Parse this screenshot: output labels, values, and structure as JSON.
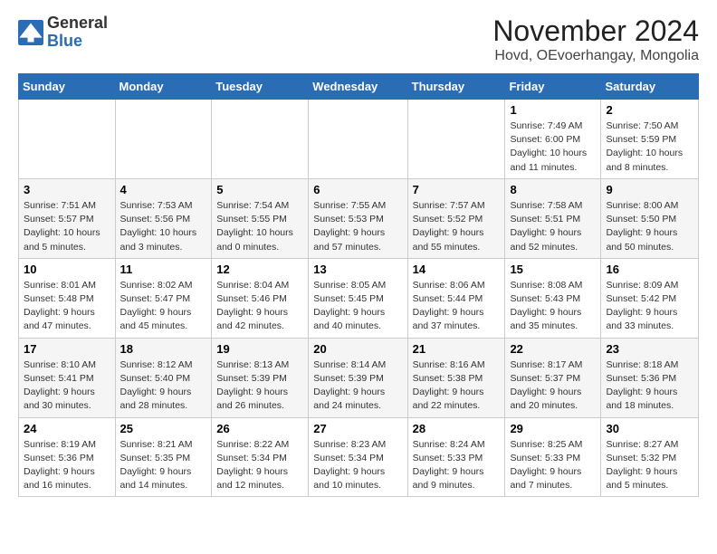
{
  "logo": {
    "general": "General",
    "blue": "Blue"
  },
  "title": "November 2024",
  "subtitle": "Hovd, OEvoerhangay, Mongolia",
  "weekdays": [
    "Sunday",
    "Monday",
    "Tuesday",
    "Wednesday",
    "Thursday",
    "Friday",
    "Saturday"
  ],
  "weeks": [
    [
      {
        "day": "",
        "info": ""
      },
      {
        "day": "",
        "info": ""
      },
      {
        "day": "",
        "info": ""
      },
      {
        "day": "",
        "info": ""
      },
      {
        "day": "",
        "info": ""
      },
      {
        "day": "1",
        "info": "Sunrise: 7:49 AM\nSunset: 6:00 PM\nDaylight: 10 hours\nand 11 minutes."
      },
      {
        "day": "2",
        "info": "Sunrise: 7:50 AM\nSunset: 5:59 PM\nDaylight: 10 hours\nand 8 minutes."
      }
    ],
    [
      {
        "day": "3",
        "info": "Sunrise: 7:51 AM\nSunset: 5:57 PM\nDaylight: 10 hours\nand 5 minutes."
      },
      {
        "day": "4",
        "info": "Sunrise: 7:53 AM\nSunset: 5:56 PM\nDaylight: 10 hours\nand 3 minutes."
      },
      {
        "day": "5",
        "info": "Sunrise: 7:54 AM\nSunset: 5:55 PM\nDaylight: 10 hours\nand 0 minutes."
      },
      {
        "day": "6",
        "info": "Sunrise: 7:55 AM\nSunset: 5:53 PM\nDaylight: 9 hours\nand 57 minutes."
      },
      {
        "day": "7",
        "info": "Sunrise: 7:57 AM\nSunset: 5:52 PM\nDaylight: 9 hours\nand 55 minutes."
      },
      {
        "day": "8",
        "info": "Sunrise: 7:58 AM\nSunset: 5:51 PM\nDaylight: 9 hours\nand 52 minutes."
      },
      {
        "day": "9",
        "info": "Sunrise: 8:00 AM\nSunset: 5:50 PM\nDaylight: 9 hours\nand 50 minutes."
      }
    ],
    [
      {
        "day": "10",
        "info": "Sunrise: 8:01 AM\nSunset: 5:48 PM\nDaylight: 9 hours\nand 47 minutes."
      },
      {
        "day": "11",
        "info": "Sunrise: 8:02 AM\nSunset: 5:47 PM\nDaylight: 9 hours\nand 45 minutes."
      },
      {
        "day": "12",
        "info": "Sunrise: 8:04 AM\nSunset: 5:46 PM\nDaylight: 9 hours\nand 42 minutes."
      },
      {
        "day": "13",
        "info": "Sunrise: 8:05 AM\nSunset: 5:45 PM\nDaylight: 9 hours\nand 40 minutes."
      },
      {
        "day": "14",
        "info": "Sunrise: 8:06 AM\nSunset: 5:44 PM\nDaylight: 9 hours\nand 37 minutes."
      },
      {
        "day": "15",
        "info": "Sunrise: 8:08 AM\nSunset: 5:43 PM\nDaylight: 9 hours\nand 35 minutes."
      },
      {
        "day": "16",
        "info": "Sunrise: 8:09 AM\nSunset: 5:42 PM\nDaylight: 9 hours\nand 33 minutes."
      }
    ],
    [
      {
        "day": "17",
        "info": "Sunrise: 8:10 AM\nSunset: 5:41 PM\nDaylight: 9 hours\nand 30 minutes."
      },
      {
        "day": "18",
        "info": "Sunrise: 8:12 AM\nSunset: 5:40 PM\nDaylight: 9 hours\nand 28 minutes."
      },
      {
        "day": "19",
        "info": "Sunrise: 8:13 AM\nSunset: 5:39 PM\nDaylight: 9 hours\nand 26 minutes."
      },
      {
        "day": "20",
        "info": "Sunrise: 8:14 AM\nSunset: 5:39 PM\nDaylight: 9 hours\nand 24 minutes."
      },
      {
        "day": "21",
        "info": "Sunrise: 8:16 AM\nSunset: 5:38 PM\nDaylight: 9 hours\nand 22 minutes."
      },
      {
        "day": "22",
        "info": "Sunrise: 8:17 AM\nSunset: 5:37 PM\nDaylight: 9 hours\nand 20 minutes."
      },
      {
        "day": "23",
        "info": "Sunrise: 8:18 AM\nSunset: 5:36 PM\nDaylight: 9 hours\nand 18 minutes."
      }
    ],
    [
      {
        "day": "24",
        "info": "Sunrise: 8:19 AM\nSunset: 5:36 PM\nDaylight: 9 hours\nand 16 minutes."
      },
      {
        "day": "25",
        "info": "Sunrise: 8:21 AM\nSunset: 5:35 PM\nDaylight: 9 hours\nand 14 minutes."
      },
      {
        "day": "26",
        "info": "Sunrise: 8:22 AM\nSunset: 5:34 PM\nDaylight: 9 hours\nand 12 minutes."
      },
      {
        "day": "27",
        "info": "Sunrise: 8:23 AM\nSunset: 5:34 PM\nDaylight: 9 hours\nand 10 minutes."
      },
      {
        "day": "28",
        "info": "Sunrise: 8:24 AM\nSunset: 5:33 PM\nDaylight: 9 hours\nand 9 minutes."
      },
      {
        "day": "29",
        "info": "Sunrise: 8:25 AM\nSunset: 5:33 PM\nDaylight: 9 hours\nand 7 minutes."
      },
      {
        "day": "30",
        "info": "Sunrise: 8:27 AM\nSunset: 5:32 PM\nDaylight: 9 hours\nand 5 minutes."
      }
    ]
  ]
}
